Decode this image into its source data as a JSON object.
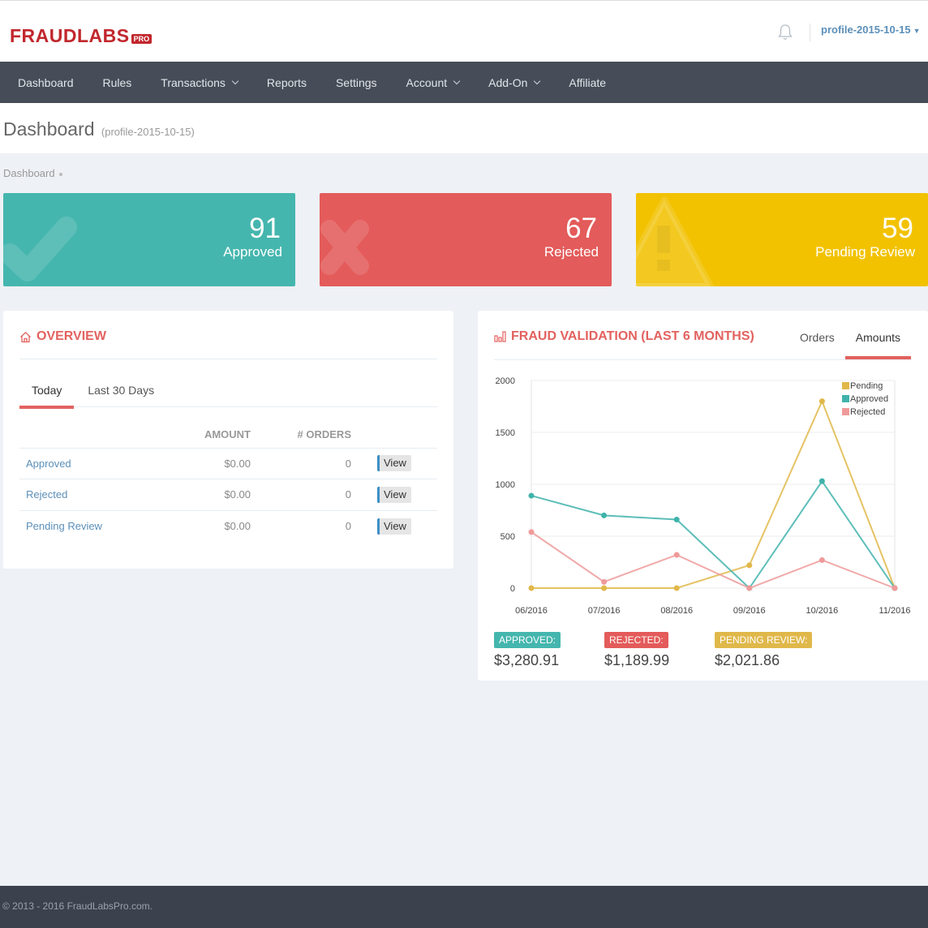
{
  "brand": {
    "name": "FRAUDLABS",
    "badge": "PRO",
    "color": "#c1272d"
  },
  "header": {
    "profile": "profile-2015-10-15",
    "bell_icon": "bell-icon"
  },
  "nav": {
    "items": [
      {
        "label": "Dashboard",
        "dropdown": false
      },
      {
        "label": "Rules",
        "dropdown": false
      },
      {
        "label": "Transactions",
        "dropdown": true
      },
      {
        "label": "Reports",
        "dropdown": false
      },
      {
        "label": "Settings",
        "dropdown": false
      },
      {
        "label": "Account",
        "dropdown": true
      },
      {
        "label": "Add-On",
        "dropdown": true
      },
      {
        "label": "Affiliate",
        "dropdown": false
      }
    ]
  },
  "page": {
    "title": "Dashboard",
    "subtitle": "(profile-2015-10-15)",
    "breadcrumb": "Dashboard"
  },
  "tiles": {
    "approved": {
      "value": "91",
      "label": "Approved",
      "color": "#45b6ae"
    },
    "rejected": {
      "value": "67",
      "label": "Rejected",
      "color": "#e35b5a"
    },
    "pending": {
      "value": "59",
      "label": "Pending Review",
      "color": "#f2c200"
    }
  },
  "overview": {
    "title": "OVERVIEW",
    "tabs": [
      "Today",
      "Last 30 Days"
    ],
    "columns": [
      "",
      "AMOUNT",
      "# ORDERS",
      ""
    ],
    "rows": [
      {
        "name": "Approved",
        "amount": "$0.00",
        "orders": "0",
        "action": "View"
      },
      {
        "name": "Rejected",
        "amount": "$0.00",
        "orders": "0",
        "action": "View"
      },
      {
        "name": "Pending Review",
        "amount": "$0.00",
        "orders": "0",
        "action": "View"
      }
    ]
  },
  "fraud_validation": {
    "title": "FRAUD VALIDATION (LAST 6 MONTHS)",
    "tabs": [
      "Orders",
      "Amounts"
    ],
    "active_tab": "Amounts",
    "summary": [
      {
        "label": "APPROVED:",
        "amount": "$3,280.91",
        "color": "#45b6ae"
      },
      {
        "label": "REJECTED:",
        "amount": "$1,189.99",
        "color": "#e35b5a"
      },
      {
        "label": "PENDING REVIEW:",
        "amount": "$2,021.86",
        "color": "#e0b84a"
      }
    ]
  },
  "chart_data": {
    "type": "line",
    "categories": [
      "06/2016",
      "07/2016",
      "08/2016",
      "09/2016",
      "10/2016",
      "11/2016"
    ],
    "ylim": [
      0,
      2000
    ],
    "yticks": [
      "0",
      "500",
      "1000",
      "1500",
      "2000"
    ],
    "grid": true,
    "legend_position": "top-right",
    "series": [
      {
        "name": "Pending",
        "color": "#e0b84a",
        "values": [
          0,
          0,
          0,
          220,
          1800,
          0
        ]
      },
      {
        "name": "Approved",
        "color": "#3fb3ab",
        "values": [
          890,
          700,
          660,
          0,
          1030,
          0
        ]
      },
      {
        "name": "Rejected",
        "color": "#ef9a9a",
        "values": [
          540,
          60,
          320,
          0,
          270,
          0
        ]
      }
    ]
  },
  "footer": {
    "text": "© 2013 - 2016 FraudLabsPro.com."
  }
}
